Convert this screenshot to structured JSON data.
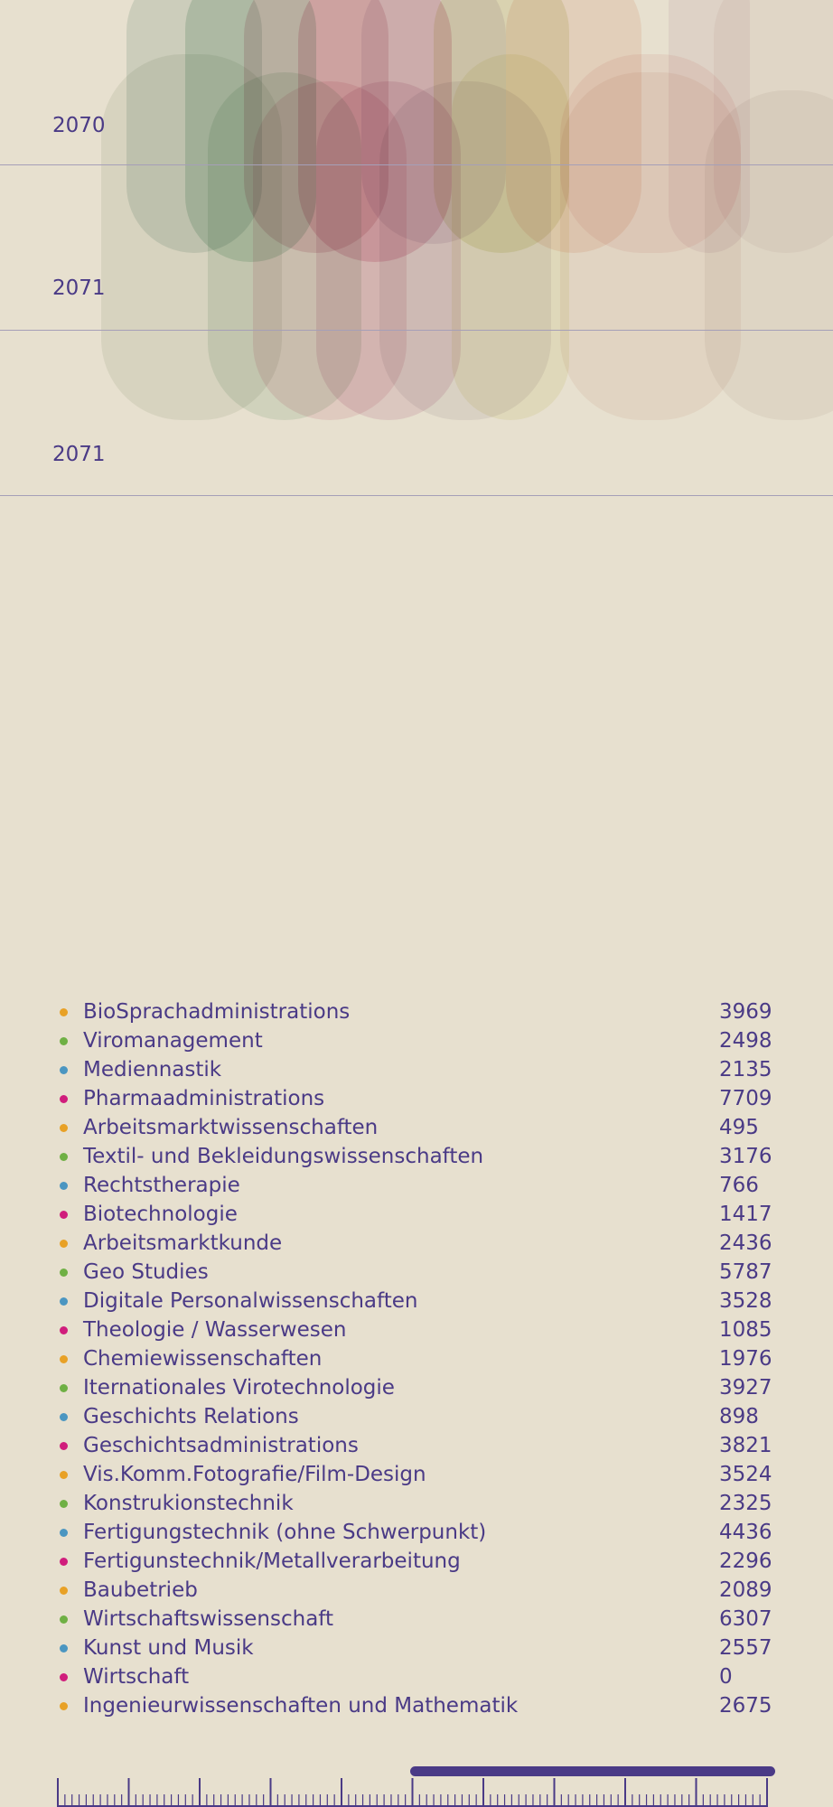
{
  "timeline": {
    "rows": [
      {
        "year": "2070"
      },
      {
        "year": "2071"
      },
      {
        "year": "2071"
      }
    ]
  },
  "legend": {
    "items": [
      {
        "label": "BioSprachadministrations",
        "value": "3969",
        "color": "#e8a126"
      },
      {
        "label": "Viromanagement",
        "value": "2498",
        "color": "#6fb044"
      },
      {
        "label": "Mediennastik",
        "value": "2135",
        "color": "#4b96c1"
      },
      {
        "label": "Pharmaadministrations",
        "value": "7709",
        "color": "#d01d7c"
      },
      {
        "label": "Arbeitsmarktwissenschaften",
        "value": "495",
        "color": "#e8a126"
      },
      {
        "label": "Textil- und Bekleidungswissenschaften",
        "value": "3176",
        "color": "#6fb044"
      },
      {
        "label": "Rechtstherapie",
        "value": "766",
        "color": "#4b96c1"
      },
      {
        "label": "Biotechnologie",
        "value": "1417",
        "color": "#d01d7c"
      },
      {
        "label": "Arbeitsmarktkunde",
        "value": "2436",
        "color": "#e8a126"
      },
      {
        "label": "Geo Studies",
        "value": "5787",
        "color": "#6fb044"
      },
      {
        "label": "Digitale Personalwissenschaften",
        "value": "3528",
        "color": "#4b96c1"
      },
      {
        "label": "Theologie / Wasserwesen",
        "value": "1085",
        "color": "#d01d7c"
      },
      {
        "label": "Chemiewissenschaften",
        "value": "1976",
        "color": "#e8a126"
      },
      {
        "label": "Iternationales Virotechnologie",
        "value": "3927",
        "color": "#6fb044"
      },
      {
        "label": "Geschichts Relations",
        "value": "898",
        "color": "#4b96c1"
      },
      {
        "label": "Geschichtsadministrations",
        "value": "3821",
        "color": "#d01d7c"
      },
      {
        "label": "Vis.Komm.Fotografie/Film-Design",
        "value": "3524",
        "color": "#e8a126"
      },
      {
        "label": "Konstrukionstechnik",
        "value": "2325",
        "color": "#6fb044"
      },
      {
        "label": "Fertigungstechnik (ohne Schwerpunkt)",
        "value": "4436",
        "color": "#4b96c1"
      },
      {
        "label": "Fertigunstechnik/Metallverarbeitung",
        "value": "2296",
        "color": "#d01d7c"
      },
      {
        "label": "Baubetrieb",
        "value": "2089",
        "color": "#e8a126"
      },
      {
        "label": "Wirtschaftswissenschaft",
        "value": "6307",
        "color": "#6fb044"
      },
      {
        "label": "Kunst und Musik",
        "value": "2557",
        "color": "#4b96c1"
      },
      {
        "label": "Wirtschaft",
        "value": "0",
        "color": "#d01d7c"
      },
      {
        "label": "Ingenieurwissenschaften und Mathematik",
        "value": "2675",
        "color": "#e8a126"
      }
    ]
  },
  "scrollbar": {
    "thumb_color": "#4a3a86"
  }
}
